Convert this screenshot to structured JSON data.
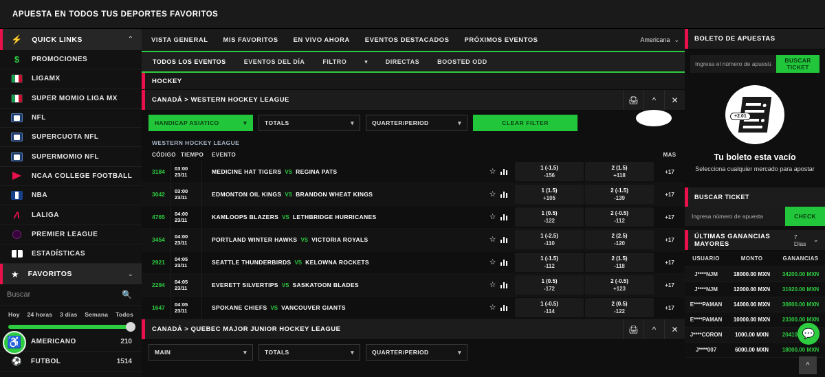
{
  "header": {
    "title": "APUESTA EN TODOS TUS DEPORTES FAVORITOS"
  },
  "sidebar": {
    "quick_links": {
      "label": "QUICK LINKS",
      "icon": "bolt-icon",
      "chevron": "⌃"
    },
    "items": [
      {
        "label": "PROMOCIONES",
        "icon": "promo-icon"
      },
      {
        "label": "LIGAMX",
        "icon": "ligamx-icon"
      },
      {
        "label": "SUPER MOMIO LIGA MX",
        "icon": "ligamx-icon"
      },
      {
        "label": "NFL",
        "icon": "nfl-icon"
      },
      {
        "label": "SUPERCUOTA NFL",
        "icon": "nfl-icon"
      },
      {
        "label": "SUPERMOMIO NFL",
        "icon": "nfl-icon"
      },
      {
        "label": "NCAA COLLEGE FOOTBALL",
        "icon": "ncaa-icon"
      },
      {
        "label": "NBA",
        "icon": "nba-icon"
      },
      {
        "label": "LALIGA",
        "icon": "laliga-icon"
      },
      {
        "label": "PREMIER LEAGUE",
        "icon": "premier-icon"
      },
      {
        "label": "ESTADÍSTICAS",
        "icon": "stats-icon"
      }
    ],
    "favorites": {
      "label": "FAVORITOS",
      "icon": "star-icon",
      "chevron": "⌄"
    },
    "search": {
      "placeholder": "Buscar",
      "value": "",
      "icon": "search-icon"
    },
    "time_filter": {
      "options": [
        "Hoy",
        "24 horas",
        "3 días",
        "Semana",
        "Todos"
      ],
      "selected": "Todos"
    },
    "sports": [
      {
        "label": "AMERICANO",
        "count": "210",
        "icon": "football-icon"
      },
      {
        "label": "FUTBOL",
        "count": "1514",
        "icon": "soccer-icon"
      }
    ],
    "accessibility_button": "accessibility-icon"
  },
  "main": {
    "primary_tabs": [
      {
        "label": "VISTA GENERAL"
      },
      {
        "label": "MIS FAVORITOS"
      },
      {
        "label": "EN VIVO AHORA"
      },
      {
        "label": "EVENTOS DESTACADOS"
      },
      {
        "label": "PRÓXIMOS EVENTOS"
      }
    ],
    "odds_format": {
      "value": "Americana",
      "chevron": "⌄"
    },
    "secondary_tabs": [
      {
        "label": "TODOS LOS EVENTOS",
        "active": true
      },
      {
        "label": "EVENTOS DEL DÍA",
        "active": false
      },
      {
        "label": "FILTRO",
        "active": false
      },
      {
        "label": "DIRECTAS",
        "active": false
      },
      {
        "label": "BOOSTED ODD",
        "active": false
      }
    ],
    "sport_header": "HOCKEY",
    "leagues": [
      {
        "title": "CANADÁ > WESTERN HOCKEY LEAGUE",
        "actions": [
          "print-icon",
          "collapse-icon",
          "close-icon"
        ],
        "filters": {
          "market": "HANDICAP ASIATICO",
          "totals": "TOTALS",
          "period": "QUARTER/PERIOD",
          "clear": "CLEAR FILTER"
        },
        "sub_league": "WESTERN HOCKEY LEAGUE",
        "columns": {
          "code": "CÓDIGO",
          "time": "TIEMPO",
          "event": "EVENTO",
          "more": "MAS"
        },
        "events": [
          {
            "code": "3184",
            "time": "03:00",
            "date": "23/11",
            "home": "MEDICINE HAT TIGERS",
            "vs": "VS",
            "away": "REGINA PATS",
            "odd1_line": "1 (-1.5)",
            "odd1_price": "-156",
            "odd2_line": "2 (1.5)",
            "odd2_price": "+118",
            "more": "+17"
          },
          {
            "code": "3042",
            "time": "03:00",
            "date": "23/11",
            "home": "EDMONTON OIL KINGS",
            "vs": "VS",
            "away": "BRANDON WHEAT KINGS",
            "odd1_line": "1 (1.5)",
            "odd1_price": "+105",
            "odd2_line": "2 (-1.5)",
            "odd2_price": "-139",
            "more": "+17"
          },
          {
            "code": "4765",
            "time": "04:00",
            "date": "23/11",
            "home": "KAMLOOPS BLAZERS",
            "vs": "VS",
            "away": "LETHBRIDGE HURRICANES",
            "odd1_line": "1 (0.5)",
            "odd1_price": "-122",
            "odd2_line": "2 (-0.5)",
            "odd2_price": "-112",
            "more": "+17"
          },
          {
            "code": "3454",
            "time": "04:00",
            "date": "23/11",
            "home": "PORTLAND WINTER HAWKS",
            "vs": "VS",
            "away": "VICTORIA ROYALS",
            "odd1_line": "1 (-2.5)",
            "odd1_price": "-110",
            "odd2_line": "2 (2.5)",
            "odd2_price": "-120",
            "more": "+17"
          },
          {
            "code": "2921",
            "time": "04:05",
            "date": "23/11",
            "home": "SEATTLE THUNDERBIRDS",
            "vs": "VS",
            "away": "KELOWNA ROCKETS",
            "odd1_line": "1 (-1.5)",
            "odd1_price": "-112",
            "odd2_line": "2 (1.5)",
            "odd2_price": "-118",
            "more": "+17"
          },
          {
            "code": "2294",
            "time": "04:05",
            "date": "23/11",
            "home": "EVERETT SILVERTIPS",
            "vs": "VS",
            "away": "SASKATOON BLADES",
            "odd1_line": "1 (0.5)",
            "odd1_price": "-172",
            "odd2_line": "2 (-0.5)",
            "odd2_price": "+123",
            "more": "+17"
          },
          {
            "code": "1647",
            "time": "04:05",
            "date": "23/11",
            "home": "SPOKANE CHIEFS",
            "vs": "VS",
            "away": "VANCOUVER GIANTS",
            "odd1_line": "1 (-0.5)",
            "odd1_price": "-114",
            "odd2_line": "2 (0.5)",
            "odd2_price": "-122",
            "more": "+17"
          }
        ]
      },
      {
        "title": "CANADÁ > QUEBEC MAJOR JUNIOR HOCKEY LEAGUE",
        "actions": [
          "print-icon",
          "collapse-icon",
          "close-icon"
        ],
        "filters": {
          "market": "MAIN",
          "totals": "TOTALS",
          "period": "QUARTER/PERIOD"
        }
      }
    ]
  },
  "betslip": {
    "title": "BOLETO DE APUESTAS",
    "ticket_search": {
      "placeholder": "Ingresa el número de apuesta",
      "value": "",
      "button": "BUSCAR TICKET"
    },
    "empty": {
      "badge": "+2.01",
      "title": "Tu boleto esta vacío",
      "subtitle": "Selecciona cualquier mercado para apostar"
    },
    "check_section": {
      "title": "BUSCAR TICKET",
      "placeholder": "Ingresa número de apuesta",
      "value": "",
      "button": "CHECK"
    },
    "winners": {
      "title": "ÚLTIMAS GANANCIAS MAYORES",
      "period": "7 Días",
      "chevron": "⌄",
      "columns": [
        "USUARIO",
        "MONTO",
        "GANANCIAS"
      ],
      "rows": [
        {
          "user": "J****NJM",
          "amount": "18000.00 MXN",
          "winnings": "34200.00 MXN"
        },
        {
          "user": "J****NJM",
          "amount": "12000.00 MXN",
          "winnings": "31920.00 MXN"
        },
        {
          "user": "E****PAMAN",
          "amount": "14000.00 MXN",
          "winnings": "30800.00 MXN"
        },
        {
          "user": "E****PAMAN",
          "amount": "10000.00 MXN",
          "winnings": "23300.00 MXN"
        },
        {
          "user": "J****CORON",
          "amount": "1000.00 MXN",
          "winnings": "20410.00 MXN"
        },
        {
          "user": "J****007",
          "amount": "6000.00 MXN",
          "winnings": "18000.00 MXN"
        }
      ]
    },
    "chat_button": "chat-icon",
    "scroll_top_button": "scroll-top-icon"
  },
  "colors": {
    "accent_green": "#2ecc40",
    "accent_red": "#e8114b",
    "background": "#0f0f0f",
    "panel": "#1c1c1c"
  }
}
